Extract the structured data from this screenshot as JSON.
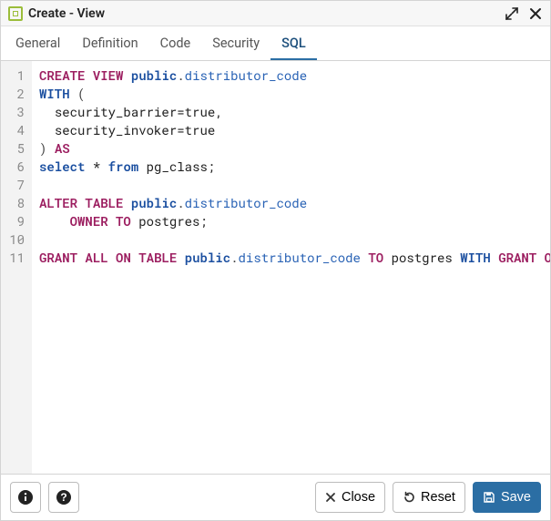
{
  "titlebar": {
    "title": "Create - View"
  },
  "tabs": [
    {
      "label": "General",
      "active": false
    },
    {
      "label": "Definition",
      "active": false
    },
    {
      "label": "Code",
      "active": false
    },
    {
      "label": "Security",
      "active": false
    },
    {
      "label": "SQL",
      "active": true
    }
  ],
  "sql_tokens": [
    [
      [
        "kw",
        "CREATE"
      ],
      [
        "sp",
        " "
      ],
      [
        "kw",
        "VIEW"
      ],
      [
        "sp",
        " "
      ],
      [
        "kw2",
        "public"
      ],
      [
        "punc",
        "."
      ],
      [
        "id",
        "distributor_code"
      ]
    ],
    [
      [
        "kw2",
        "WITH"
      ],
      [
        "sp",
        " "
      ],
      [
        "punc",
        "("
      ]
    ],
    [
      [
        "sp",
        "  "
      ],
      [
        "txt",
        "security_barrier=true,"
      ]
    ],
    [
      [
        "sp",
        "  "
      ],
      [
        "txt",
        "security_invoker=true"
      ]
    ],
    [
      [
        "punc",
        ")"
      ],
      [
        "sp",
        " "
      ],
      [
        "kw",
        "AS"
      ]
    ],
    [
      [
        "kw2",
        "select"
      ],
      [
        "sp",
        " "
      ],
      [
        "txt",
        "*"
      ],
      [
        "sp",
        " "
      ],
      [
        "kw2",
        "from"
      ],
      [
        "sp",
        " "
      ],
      [
        "txt",
        "pg_class;"
      ]
    ],
    [],
    [
      [
        "kw",
        "ALTER"
      ],
      [
        "sp",
        " "
      ],
      [
        "kw",
        "TABLE"
      ],
      [
        "sp",
        " "
      ],
      [
        "kw2",
        "public"
      ],
      [
        "punc",
        "."
      ],
      [
        "id",
        "distributor_code"
      ]
    ],
    [
      [
        "sp",
        "    "
      ],
      [
        "kw",
        "OWNER"
      ],
      [
        "sp",
        " "
      ],
      [
        "kw",
        "TO"
      ],
      [
        "sp",
        " "
      ],
      [
        "txt",
        "postgres;"
      ]
    ],
    [],
    [
      [
        "kw",
        "GRANT"
      ],
      [
        "sp",
        " "
      ],
      [
        "kw",
        "ALL"
      ],
      [
        "sp",
        " "
      ],
      [
        "kw",
        "ON"
      ],
      [
        "sp",
        " "
      ],
      [
        "kw",
        "TABLE"
      ],
      [
        "sp",
        " "
      ],
      [
        "kw2",
        "public"
      ],
      [
        "punc",
        "."
      ],
      [
        "id",
        "distributor_code"
      ],
      [
        "sp",
        " "
      ],
      [
        "kw",
        "TO"
      ],
      [
        "sp",
        " "
      ],
      [
        "txt",
        "postgres"
      ],
      [
        "sp",
        " "
      ],
      [
        "kw2",
        "WITH"
      ],
      [
        "sp",
        " "
      ],
      [
        "kw",
        "GRANT"
      ],
      [
        "sp",
        " "
      ],
      [
        "kw",
        "OPTION"
      ],
      [
        "punc",
        ";"
      ]
    ]
  ],
  "footer": {
    "close_label": "Close",
    "reset_label": "Reset",
    "save_label": "Save"
  }
}
